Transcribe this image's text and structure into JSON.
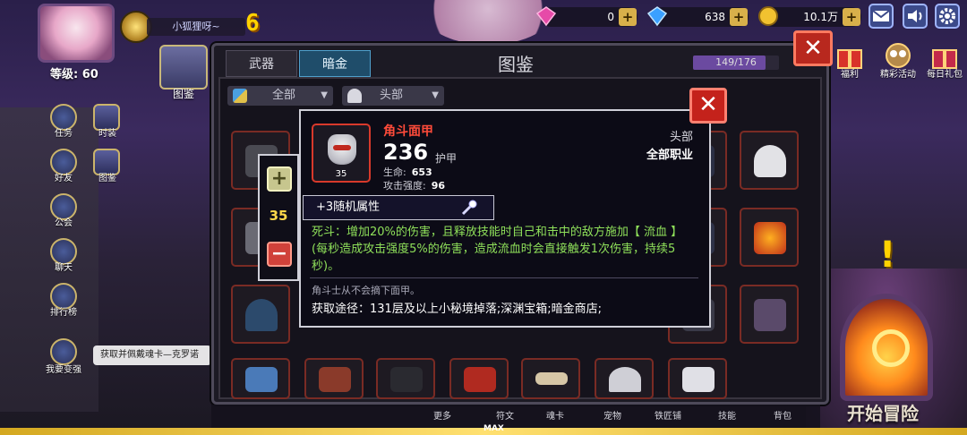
{
  "player": {
    "name": "小狐狸呀~",
    "level_label": "等级: 60"
  },
  "resources": [
    {
      "icon": "pink-gem-icon",
      "value": "0",
      "plus": "+"
    },
    {
      "icon": "blue-diamond-icon",
      "value": "638",
      "plus": "+"
    },
    {
      "icon": "gold-coin-icon",
      "value": "10.1万",
      "plus": "+"
    }
  ],
  "top_activities": [
    {
      "label": "福利"
    },
    {
      "label": "精彩活动"
    },
    {
      "label": "每日礼包"
    }
  ],
  "side_menu": {
    "left": [
      {
        "label": "任务"
      },
      {
        "label": "好友"
      },
      {
        "label": "公会"
      },
      {
        "label": "聊天"
      },
      {
        "label": "排行榜"
      },
      {
        "label": "我要变强"
      }
    ],
    "right": [
      {
        "label": "时装"
      },
      {
        "label": "图鉴"
      }
    ],
    "codex_button": "图鉴"
  },
  "notice": "获取并佩戴魂卡—克罗诺",
  "codex": {
    "title": "图鉴",
    "tabs": [
      "武器",
      "暗金"
    ],
    "active_tab": "暗金",
    "progress": {
      "text": "149/176",
      "fraction": 0.847
    },
    "filters": [
      {
        "label": "全部",
        "icon": "grid-icon"
      },
      {
        "label": "头部",
        "icon": "helmet-icon"
      }
    ]
  },
  "item_tooltip": {
    "name": "角斗面甲",
    "value": "236",
    "value_unit": "护甲",
    "stats": [
      {
        "label": "生命:",
        "value": "653"
      },
      {
        "label": "攻击强度:",
        "value": "96"
      }
    ],
    "icon_count": "35",
    "slot": "头部",
    "class": "全部职业",
    "random_attr": "+3随机属性",
    "skill": "死斗：增加20%的伤害，且释放技能时自己和击中的敌方施加【 流血 】(每秒造成攻击强度5%的伤害，造成流血时会直接触发1次伤害，持续5秒)。",
    "flavor": "角斗士从不会摘下面甲。",
    "source": "获取途径：131层及以上小秘境掉落;深渊宝箱;暗金商店;"
  },
  "level_selector": {
    "plus": "+",
    "value": "35",
    "minus": "−"
  },
  "bottom_nav": [
    "更多",
    "符文",
    "魂卡",
    "宠物",
    "铁匠铺",
    "技能",
    "背包"
  ],
  "max_label": "MAX",
  "start_button": "开始冒险",
  "colors": {
    "accent_red": "#c4221b",
    "skill_green": "#8fe05a",
    "item_name_red": "#ff4b3a",
    "gold": "#ffd200"
  }
}
